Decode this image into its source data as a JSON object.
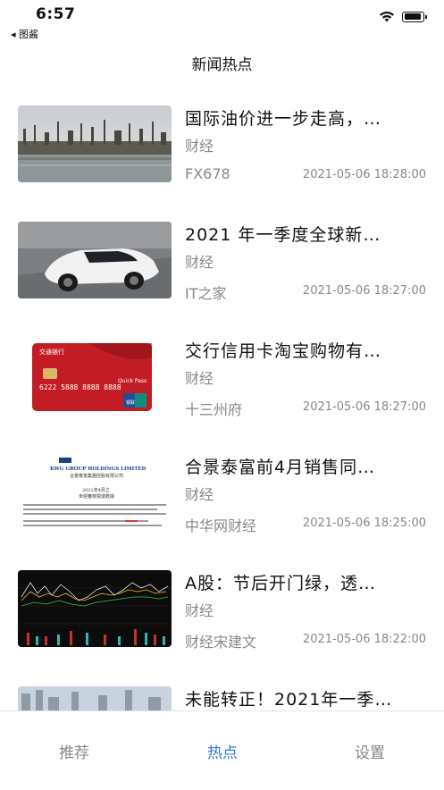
{
  "status": {
    "time": "6:57",
    "back_app": "◂ 图酱"
  },
  "nav": {
    "title": "新闻热点"
  },
  "news": [
    {
      "headline": "国际油价进一步走高，…",
      "category": "财经",
      "source": "FX678",
      "time": "2021-05-06 18:28:00"
    },
    {
      "headline": "2021 年一季度全球新…",
      "category": "财经",
      "source": "IT之家",
      "time": "2021-05-06 18:27:00"
    },
    {
      "headline": "交行信用卡淘宝购物有…",
      "category": "财经",
      "source": "十三州府",
      "time": "2021-05-06 18:27:00"
    },
    {
      "headline": "合景泰富前4月销售同…",
      "category": "财经",
      "source": "中华网财经",
      "time": "2021-05-06 18:25:00"
    },
    {
      "headline": "A股：节后开门绿，透…",
      "category": "财经",
      "source": "财经宋建文",
      "time": "2021-05-06 18:22:00"
    },
    {
      "headline": "未能转正！2021年一季…",
      "category": "",
      "source": "",
      "time": ""
    }
  ],
  "card_text": {
    "bank_name": "交通银行",
    "card_number": "6222 5888 8888 8888",
    "quickpass": "Quick Pass",
    "unionpay": "银联"
  },
  "doc_text": {
    "company_en": "KWG GROUP HOLDINGS LIMITED",
    "company_cn": "合景泰富集團控股有限公司",
    "date_line": "2021年4月之",
    "title_line": "未經審核營運數據"
  },
  "tabs": [
    {
      "label": "推荐",
      "active": false
    },
    {
      "label": "热点",
      "active": true
    },
    {
      "label": "设置",
      "active": false
    }
  ],
  "colors": {
    "accent": "#2f7ae5",
    "secondary_text": "#888888"
  }
}
